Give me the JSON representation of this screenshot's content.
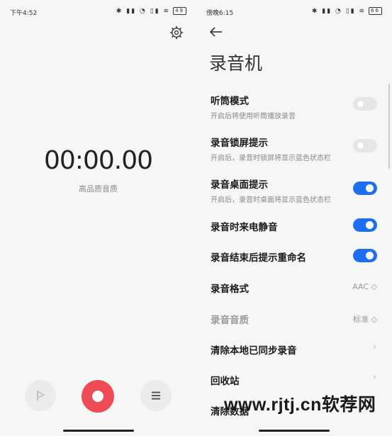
{
  "left": {
    "status": {
      "time": "下午4:52",
      "icons": "✱ ▮▮ ◔ ▯▮ ≋",
      "battery": "49"
    },
    "timer": "00:00.00",
    "quality": "高品质音质"
  },
  "right": {
    "status": {
      "time": "傍晚6:15",
      "icons": "✱ ▮▮ ◔ ▯▮ ≋",
      "battery": "66"
    },
    "title": "录音机",
    "settings": [
      {
        "label": "听筒模式",
        "sub": "开启后将使用听筒播放录音",
        "toggle": "off"
      },
      {
        "label": "录音锁屏提示",
        "sub": "开启后，录音时锁屏将显示蓝色状态栏",
        "toggle": "off"
      },
      {
        "label": "录音桌面提示",
        "sub": "开启后，录音时桌面将显示蓝色状态栏",
        "toggle": "on"
      },
      {
        "label": "录音时来电静音",
        "toggle": "on"
      },
      {
        "label": "录音结束后提示重命名",
        "toggle": "on"
      },
      {
        "label": "录音格式",
        "value": "AAC ◇"
      },
      {
        "label": "录音音质",
        "value": "标准 ◇"
      },
      {
        "label": "清除本地已同步录音",
        "chevron": "›"
      },
      {
        "label": "回收站",
        "chevron": "›"
      },
      {
        "label": "清除数据"
      }
    ]
  },
  "watermark": "www.rjtj.cn软荐网",
  "colors": {
    "accent": "#1d6ff0",
    "record": "#ee4b55"
  }
}
